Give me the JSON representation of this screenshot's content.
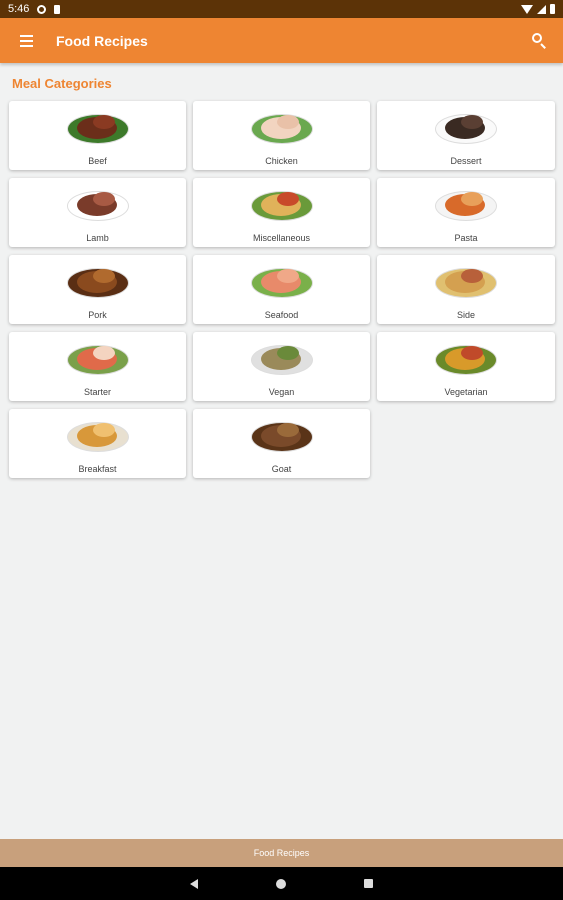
{
  "status_bar": {
    "time": "5:46"
  },
  "app_bar": {
    "title": "Food Recipes"
  },
  "section": {
    "title": "Meal Categories"
  },
  "categories": [
    {
      "label": "Beef",
      "icon": "beef-image"
    },
    {
      "label": "Chicken",
      "icon": "chicken-image"
    },
    {
      "label": "Dessert",
      "icon": "dessert-image"
    },
    {
      "label": "Lamb",
      "icon": "lamb-image"
    },
    {
      "label": "Miscellaneous",
      "icon": "miscellaneous-image"
    },
    {
      "label": "Pasta",
      "icon": "pasta-image"
    },
    {
      "label": "Pork",
      "icon": "pork-image"
    },
    {
      "label": "Seafood",
      "icon": "seafood-image"
    },
    {
      "label": "Side",
      "icon": "side-image"
    },
    {
      "label": "Starter",
      "icon": "starter-image"
    },
    {
      "label": "Vegan",
      "icon": "vegan-image"
    },
    {
      "label": "Vegetarian",
      "icon": "vegetarian-image"
    },
    {
      "label": "Breakfast",
      "icon": "breakfast-image"
    },
    {
      "label": "Goat",
      "icon": "goat-image"
    }
  ],
  "bottom_bar": {
    "label": "Food Recipes"
  },
  "colors": {
    "primary": "#ee8532",
    "status_bar": "#5c3307",
    "footer": "#c8a07c",
    "background": "#f1f2f2"
  }
}
